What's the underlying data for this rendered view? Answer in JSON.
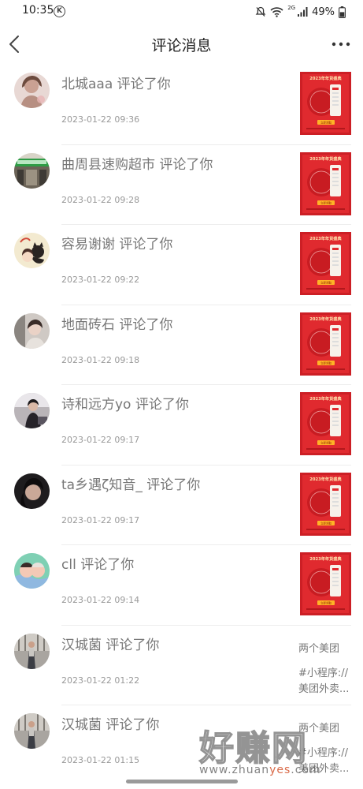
{
  "status": {
    "time": "10:35",
    "k_badge": "K",
    "net_label": "2G",
    "battery": "49%"
  },
  "header": {
    "title": "评论消息"
  },
  "thumb": {
    "banner_text": "2023年年货盛典",
    "cta_text": "立即领取"
  },
  "messages": [
    {
      "title": "北城aaa 评论了你",
      "time": "2023-01-22 09:36"
    },
    {
      "title": "曲周县速购超市 评论了你",
      "time": "2023-01-22 09:28"
    },
    {
      "title": "容易谢谢 评论了你",
      "time": "2023-01-22 09:22"
    },
    {
      "title": "地面砖石 评论了你",
      "time": "2023-01-22 09:18"
    },
    {
      "title": "诗和远方yo 评论了你",
      "time": "2023-01-22 09:17"
    },
    {
      "title": "ta乡遇ζ知音_ 评论了你",
      "time": "2023-01-22 09:17"
    },
    {
      "title": "cll 评论了你",
      "time": "2023-01-22 09:14"
    },
    {
      "title": "汉城菌 评论了你",
      "time": "2023-01-22 01:22",
      "side_text": "两个美团",
      "side_sub": "#小程序://美团外卖..."
    },
    {
      "title": "汉城菌 评论了你",
      "time": "2023-01-22 01:15",
      "side_text": "两个美团",
      "side_sub": "#小程序://美团外卖..."
    }
  ],
  "watermark": {
    "big_text": "好赚网",
    "url_prefix": "www.zhuan",
    "url_accent": "yes",
    "url_suffix": ".com"
  },
  "colors": {
    "accent_red": "#d9252b",
    "title_gray": "#777777",
    "time_gray": "#999999"
  }
}
